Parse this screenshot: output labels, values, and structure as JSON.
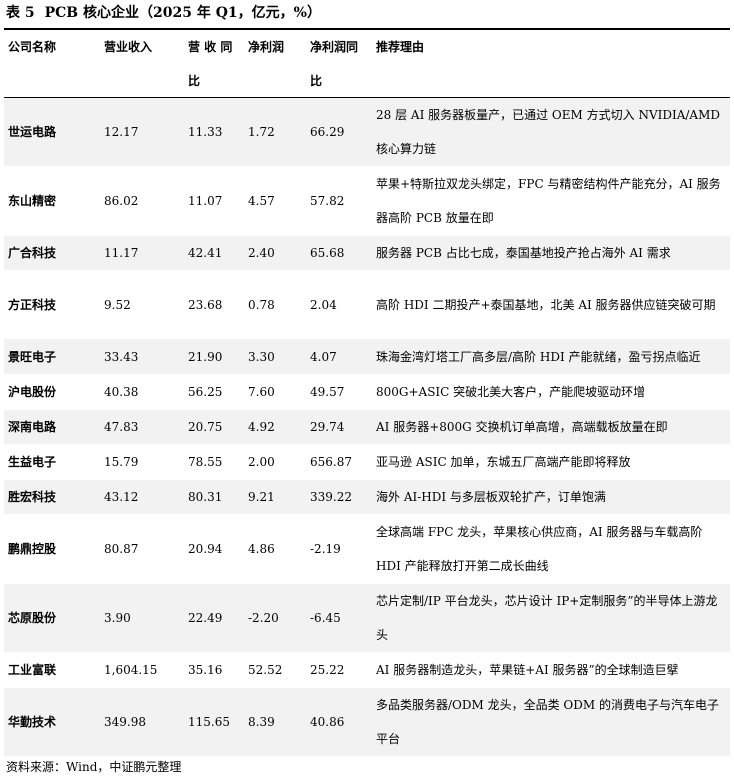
{
  "title": {
    "label": "表 5",
    "text": "PCB 核心企业（2025 年 Q1，亿元，%）"
  },
  "headers": [
    [
      "公司名称",
      ""
    ],
    [
      "营业收入",
      ""
    ],
    [
      "营 收 同",
      "比"
    ],
    [
      "净利润",
      ""
    ],
    [
      "净利润同",
      "比"
    ],
    [
      "推荐理由",
      ""
    ]
  ],
  "rows": [
    {
      "name": "世运电路",
      "revenue": "12.17",
      "rev_yoy": "11.33",
      "profit": "1.72",
      "profit_yoy": "66.29",
      "reason": "28 层 AI 服务器板量产，已通过 OEM 方式切入 NVIDIA/AMD 核心算力链"
    },
    {
      "name": "东山精密",
      "revenue": "86.02",
      "rev_yoy": "11.07",
      "profit": "4.57",
      "profit_yoy": "57.82",
      "reason": "苹果+特斯拉双龙头绑定，FPC 与精密结构件产能充分，AI 服务器高阶 PCB 放量在即"
    },
    {
      "name": "广合科技",
      "revenue": "11.17",
      "rev_yoy": "42.41",
      "profit": "2.40",
      "profit_yoy": "65.68",
      "reason": "服务器 PCB 占比七成，泰国基地投产抢占海外 AI 需求"
    },
    {
      "name": "方正科技",
      "revenue": "9.52",
      "rev_yoy": "23.68",
      "profit": "0.78",
      "profit_yoy": "2.04",
      "reason": "高阶 HDI 二期投产+泰国基地，北美 AI 服务器供应链突破可期"
    },
    {
      "name": "景旺电子",
      "revenue": "33.43",
      "rev_yoy": "21.90",
      "profit": "3.30",
      "profit_yoy": "4.07",
      "reason": "珠海金湾灯塔工厂高多层/高阶 HDI 产能就绪，盈亏拐点临近"
    },
    {
      "name": "沪电股份",
      "revenue": "40.38",
      "rev_yoy": "56.25",
      "profit": "7.60",
      "profit_yoy": "49.57",
      "reason": "800G+ASIC 突破北美大客户，产能爬坡驱动环增"
    },
    {
      "name": "深南电路",
      "revenue": "47.83",
      "rev_yoy": "20.75",
      "profit": "4.92",
      "profit_yoy": "29.74",
      "reason": "AI 服务器+800G 交换机订单高增，高端载板放量在即"
    },
    {
      "name": "生益电子",
      "revenue": "15.79",
      "rev_yoy": "78.55",
      "profit": "2.00",
      "profit_yoy": "656.87",
      "reason": "亚马逊 ASIC 加单，东城五厂高端产能即将释放"
    },
    {
      "name": "胜宏科技",
      "revenue": "43.12",
      "rev_yoy": "80.31",
      "profit": "9.21",
      "profit_yoy": "339.22",
      "reason": "海外 AI-HDI 与多层板双轮扩产，订单饱满"
    },
    {
      "name": "鹏鼎控股",
      "revenue": "80.87",
      "rev_yoy": "20.94",
      "profit": "4.86",
      "profit_yoy": "-2.19",
      "reason": "全球高端 FPC 龙头，苹果核心供应商，AI 服务器与车载高阶 HDI 产能释放打开第二成长曲线"
    },
    {
      "name": "芯原股份",
      "revenue": "3.90",
      "rev_yoy": "22.49",
      "profit": "-2.20",
      "profit_yoy": "-6.45",
      "reason": "芯片定制/IP 平台龙头，芯片设计 IP+定制服务”的半导体上游龙头"
    },
    {
      "name": "工业富联",
      "revenue": "1,604.15",
      "rev_yoy": "35.16",
      "profit": "52.52",
      "profit_yoy": "25.22",
      "reason": "AI 服务器制造龙头，苹果链+AI 服务器”的全球制造巨擘"
    },
    {
      "name": "华勤技术",
      "revenue": "349.98",
      "rev_yoy": "115.65",
      "profit": "8.39",
      "profit_yoy": "40.86",
      "reason": "多品类服务器/ODM 龙头，全品类 ODM 的消费电子与汽车电子平台"
    }
  ],
  "source": "资料来源：Wind，中证鹏元整理"
}
